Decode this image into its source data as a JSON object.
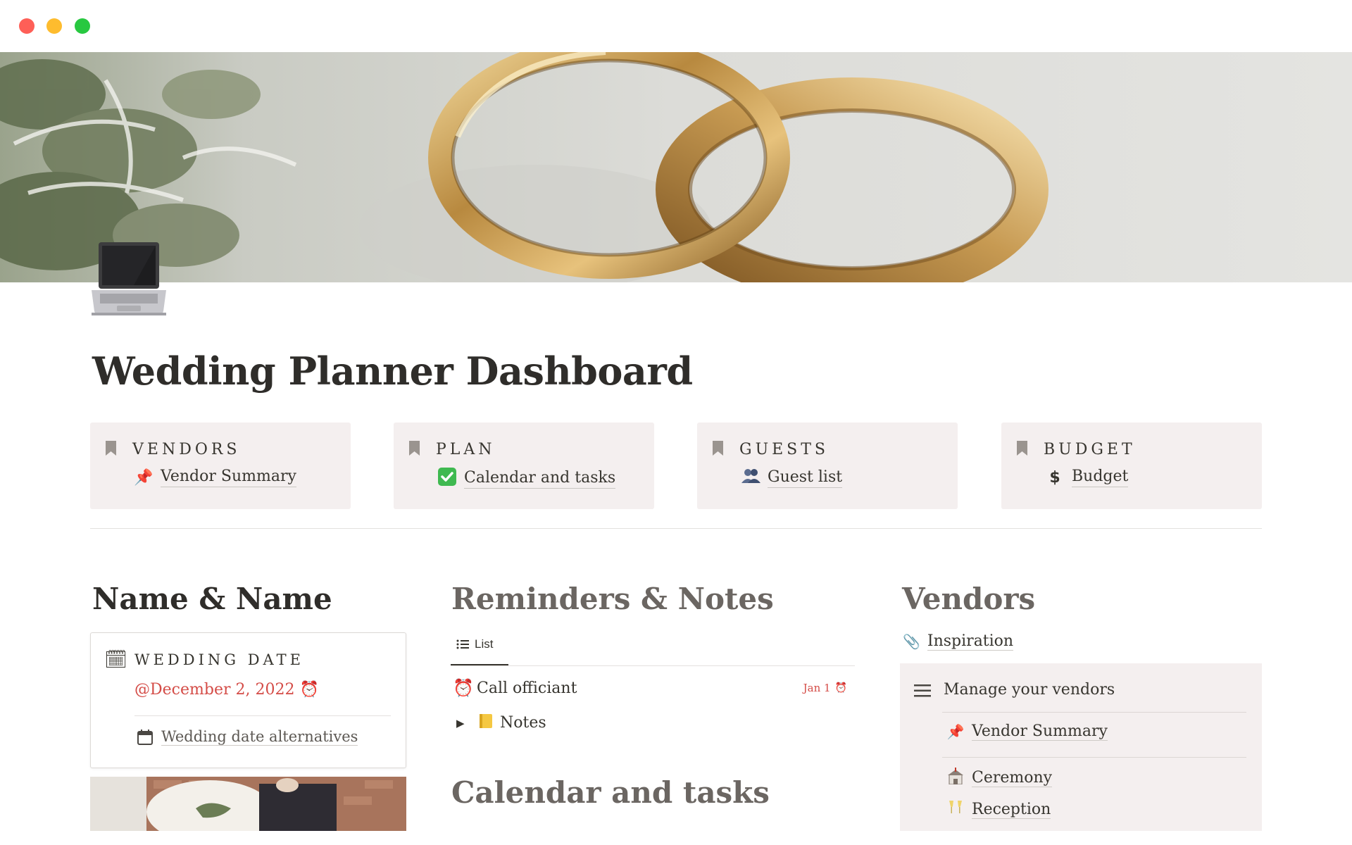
{
  "window": {
    "controls": [
      "close",
      "minimize",
      "zoom"
    ]
  },
  "page": {
    "icon": "laptop-icon",
    "title": "Wedding Planner Dashboard"
  },
  "nav_cards": [
    {
      "heading": "VENDORS",
      "link_icon": "pushpin-icon",
      "link_label": "Vendor Summary"
    },
    {
      "heading": "PLAN",
      "link_icon": "check-mark-icon",
      "link_label": "Calendar and tasks"
    },
    {
      "heading": "GUESTS",
      "link_icon": "people-icon",
      "link_label": "Guest list"
    },
    {
      "heading": "BUDGET",
      "link_icon": "dollar-icon",
      "link_label": "Budget"
    }
  ],
  "couple": {
    "heading": "Name & Name",
    "wedding_date_label": "WEDDING DATE",
    "wedding_date_value": "@December 2, 2022",
    "alternatives_label": "Wedding date alternatives"
  },
  "reminders": {
    "heading": "Reminders & Notes",
    "view_tab": "List",
    "items": [
      {
        "icon": "alarm-clock-icon",
        "label": "Call officiant",
        "due": "Jan 1"
      }
    ],
    "notes_label": "Notes"
  },
  "calendar": {
    "heading": "Calendar and tasks"
  },
  "vendors": {
    "heading": "Vendors",
    "inspiration_label": "Inspiration",
    "manage_label": "Manage your vendors",
    "items": [
      {
        "icon": "pushpin-icon",
        "label": "Vendor Summary"
      },
      {
        "icon": "church-icon",
        "label": "Ceremony"
      },
      {
        "icon": "clinking-glasses-icon",
        "label": "Reception"
      }
    ]
  },
  "colors": {
    "card_bg": "#f4efef",
    "accent_red": "#d44c47",
    "text": "#37352f",
    "heading_grey": "#6b6662"
  }
}
